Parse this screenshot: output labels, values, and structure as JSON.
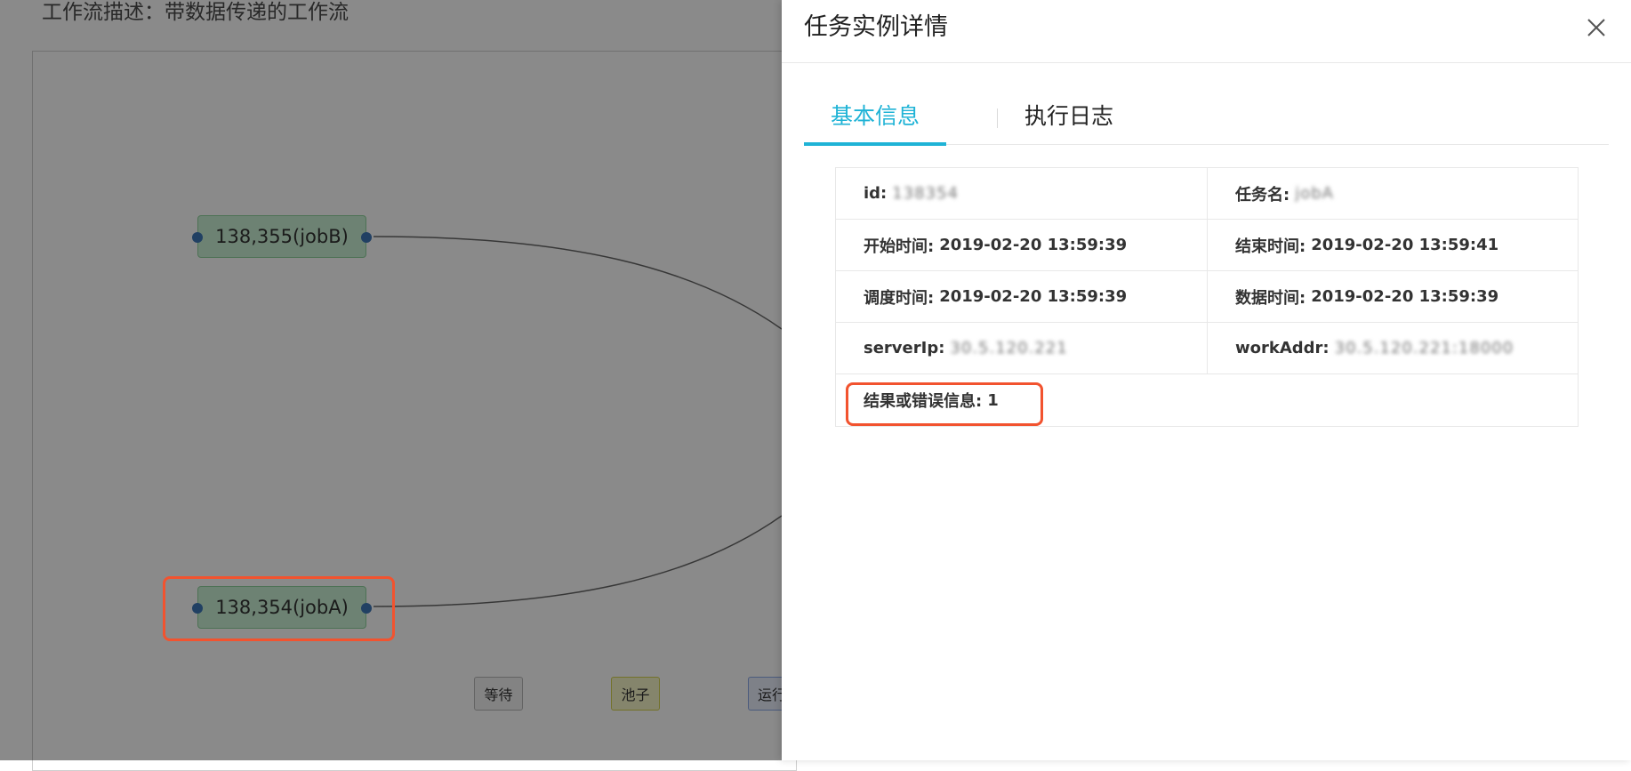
{
  "workflow": {
    "description": "工作流描述：带数据传递的工作流",
    "nodes": [
      {
        "label": "138,355(jobB)"
      },
      {
        "label": "138,354(jobA)"
      }
    ],
    "legend": [
      "等待",
      "池子",
      "运行"
    ],
    "legend_colors": {
      "waiting": "#b8b8b8",
      "pool": "#e4e36a",
      "running": "#8ba8e8"
    }
  },
  "drawer": {
    "title": "任务实例详情",
    "close_icon": "close-icon",
    "tabs": [
      {
        "label": "基本信息",
        "active": true
      },
      {
        "label": "执行日志",
        "active": false
      }
    ],
    "fields": {
      "id": {
        "label": "id:",
        "value": "138354"
      },
      "task_name": {
        "label": "任务名:",
        "value": "jobA"
      },
      "start_time": {
        "label": "开始时间:",
        "value": "2019-02-20 13:59:39"
      },
      "end_time": {
        "label": "结束时间:",
        "value": "2019-02-20 13:59:41"
      },
      "schedule_time": {
        "label": "调度时间:",
        "value": "2019-02-20 13:59:39"
      },
      "data_time": {
        "label": "数据时间:",
        "value": "2019-02-20 13:59:39"
      },
      "server_ip": {
        "label": "serverIp:",
        "value": "30.5.120.221"
      },
      "work_addr": {
        "label": "workAddr:",
        "value": "30.5.120.221:18000"
      },
      "result": {
        "label": "结果或错误信息:",
        "value": "1"
      }
    }
  },
  "colors": {
    "accent": "#1fb3d6",
    "highlight": "#f2532f",
    "node_fill": "#c9f1d4",
    "port": "#3d76b8"
  }
}
